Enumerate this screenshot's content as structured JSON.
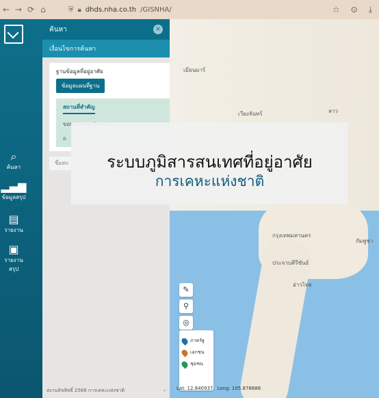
{
  "browser": {
    "url_host": "dhds.nha.co.th",
    "url_path": "/GISNHA/"
  },
  "sidebar": {
    "items": [
      {
        "label": "ค้นหา",
        "icon": "search-icon"
      },
      {
        "label": "ข้อมูลสรุป",
        "icon": "bar-chart-icon"
      },
      {
        "label": "รายงาน",
        "icon": "report-icon"
      },
      {
        "label": "รายงานสรุป",
        "icon": "summary-report-icon"
      }
    ]
  },
  "panel": {
    "title": "ค้นหา",
    "subheader": "เงื่อนไขการค้นหา",
    "layers_label": "ฐานข้อมูลที่อยู่อาศัย",
    "chip": "ข้อมูลแผนที่ฐาน",
    "sublist": {
      "active": "สถานที่สำคัญ",
      "items": [
        "ขอบเขตการปกครอง",
        "ถ"
      ]
    },
    "input_placeholder": "ชื่อสถ",
    "footer_text": "สงวนลิขสิทธิ์ 2568 การเคหะแห่งชาติ"
  },
  "map": {
    "labels": [
      "เมียนมาร์",
      "เวียงจันทร์",
      "ลาว",
      "กัมพูชา",
      "อ่าวไทย",
      "ประจวบคีรีขันธ์",
      "กรุงเทพมหานคร"
    ],
    "legend": [
      {
        "label": "ภาครัฐ",
        "color": "#1f6fb0"
      },
      {
        "label": "เอกชน",
        "color": "#c8782a"
      },
      {
        "label": "ชุมชน",
        "color": "#1f9a55"
      }
    ],
    "coords": {
      "lat": "Lat: 12.840937",
      "long": "Long: 105.878686"
    }
  },
  "overlay": {
    "title": "ระบบภูมิสารสนเทศที่อยู่อาศัย",
    "subtitle": "การเคหะแห่งชาติ"
  }
}
